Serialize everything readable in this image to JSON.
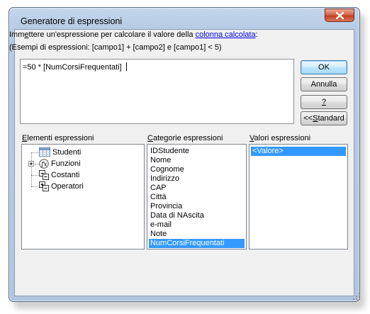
{
  "window": {
    "title": "Generatore di espressioni"
  },
  "instructions": {
    "line1_pre": "Imm",
    "line1_accel": "e",
    "line1_mid": "ttere un'espressione per calcolare il valore della ",
    "line1_link": "colonna calcolata",
    "line1_post": ":",
    "line2": "(Esempi di espressioni: [campo1] + [campo2] e [campo1] < 5)"
  },
  "expression": {
    "value": "=50 * [NumCorsiFrequentati]"
  },
  "buttons": {
    "ok": "OK",
    "cancel": "Annulla",
    "help": "?",
    "standard_pre": "<< ",
    "standard_accel": "S",
    "standard_post": "tandard"
  },
  "elements": {
    "label_accel": "E",
    "label_rest": "lementi espressioni",
    "items": [
      {
        "label": "Studenti",
        "icon": "table-icon"
      },
      {
        "label": "Funzioni",
        "icon": "function-icon",
        "expandable": true
      },
      {
        "label": "Costanti",
        "icon": "constants-icon"
      },
      {
        "label": "Operatori",
        "icon": "operators-icon"
      }
    ]
  },
  "categories": {
    "label_accel": "C",
    "label_rest": "ategorie espressioni",
    "items": [
      "IDStudente",
      "Nome",
      "Cognome",
      "Indirizzo",
      "CAP",
      "Città",
      "Provincia",
      "Data di NAscita",
      "e-mail",
      "Note",
      "NumCorsiFrequentati"
    ],
    "selected": "NumCorsiFrequentati"
  },
  "values": {
    "label_accel": "V",
    "label_rest": "alori espressioni",
    "items": [
      "<Valore>"
    ]
  },
  "colors": {
    "selection": "#3399ff",
    "link": "#0000ee",
    "frame": "#b6cbe5",
    "close": "#c1401f"
  }
}
